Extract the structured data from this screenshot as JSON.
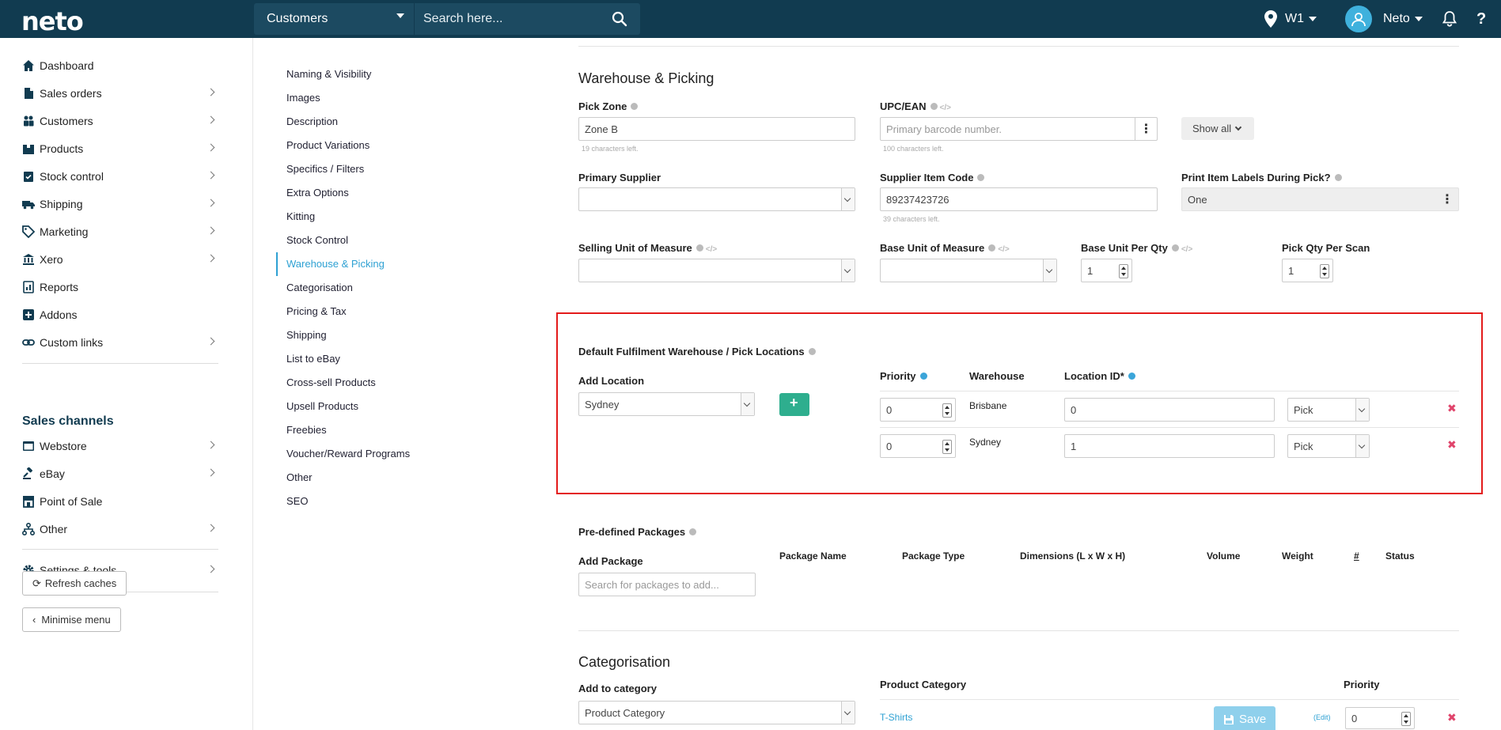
{
  "topbar": {
    "logo": "neto",
    "search_scope": "Customers",
    "search_placeholder": "Search here...",
    "location": "W1",
    "user_name": "Neto",
    "help": "?"
  },
  "sidebar": {
    "items": [
      {
        "label": "Dashboard"
      },
      {
        "label": "Sales orders"
      },
      {
        "label": "Customers"
      },
      {
        "label": "Products"
      },
      {
        "label": "Stock control"
      },
      {
        "label": "Shipping"
      },
      {
        "label": "Marketing"
      },
      {
        "label": "Xero"
      },
      {
        "label": "Reports"
      },
      {
        "label": "Addons"
      },
      {
        "label": "Custom links"
      }
    ],
    "sales_channels_heading": "Sales channels",
    "channels": [
      {
        "label": "Webstore"
      },
      {
        "label": "eBay"
      },
      {
        "label": "Point of Sale"
      },
      {
        "label": "Other"
      }
    ],
    "settings": "Settings & tools",
    "refresh": "Refresh caches",
    "minimise": "Minimise menu"
  },
  "subnav": [
    "Naming & Visibility",
    "Images",
    "Description",
    "Product Variations",
    "Specifics / Filters",
    "Extra Options",
    "Kitting",
    "Stock Control",
    "Warehouse & Picking",
    "Categorisation",
    "Pricing & Tax",
    "Shipping",
    "List to eBay",
    "Cross-sell Products",
    "Upsell Products",
    "Freebies",
    "Voucher/Reward Programs",
    "Other",
    "SEO"
  ],
  "warehouse": {
    "title": "Warehouse & Picking",
    "pick_zone_label": "Pick Zone",
    "pick_zone_value": "Zone B",
    "pick_zone_help": "19 characters left.",
    "upc_label": "UPC/EAN",
    "upc_placeholder": "Primary barcode number.",
    "upc_help": "100 characters left.",
    "show_all": "Show all",
    "primary_supplier_label": "Primary Supplier",
    "supplier_code_label": "Supplier Item Code",
    "supplier_code_value": "89237423726",
    "supplier_code_help": "39 characters left.",
    "print_labels_label": "Print Item Labels During Pick?",
    "print_labels_value": "One",
    "selling_uom_label": "Selling Unit of Measure",
    "base_uom_label": "Base Unit of Measure",
    "base_unit_qty_label": "Base Unit Per Qty",
    "base_unit_qty_value": "1",
    "pick_qty_label": "Pick Qty Per Scan",
    "pick_qty_value": "1"
  },
  "fulfilment": {
    "title": "Default Fulfilment Warehouse / Pick Locations",
    "add_location_label": "Add Location",
    "add_location_value": "Sydney",
    "col_priority": "Priority",
    "col_warehouse": "Warehouse",
    "col_location": "Location ID*",
    "rows": [
      {
        "priority": "0",
        "warehouse": "Brisbane",
        "location_id": "0",
        "type": "Pick"
      },
      {
        "priority": "0",
        "warehouse": "Sydney",
        "location_id": "1",
        "type": "Pick"
      }
    ]
  },
  "packages": {
    "title": "Pre-defined Packages",
    "add_label": "Add Package",
    "search_placeholder": "Search for packages to add...",
    "columns": [
      "Package Name",
      "Package Type",
      "Dimensions (L x W x H)",
      "Volume",
      "Weight",
      "#",
      "Status"
    ]
  },
  "categorisation": {
    "title": "Categorisation",
    "add_label": "Add to category",
    "add_value": "Product Category",
    "col_category": "Product Category",
    "col_priority": "Priority",
    "row_category": "T-Shirts",
    "row_edit": "(Edit)",
    "row_priority": "0",
    "save": "Save"
  },
  "colors": {
    "topbar": "#113b50",
    "accent": "#2ea1d3",
    "add_button": "#2eae8e",
    "delete": "#e0446b",
    "highlight": "#e31b1b"
  }
}
